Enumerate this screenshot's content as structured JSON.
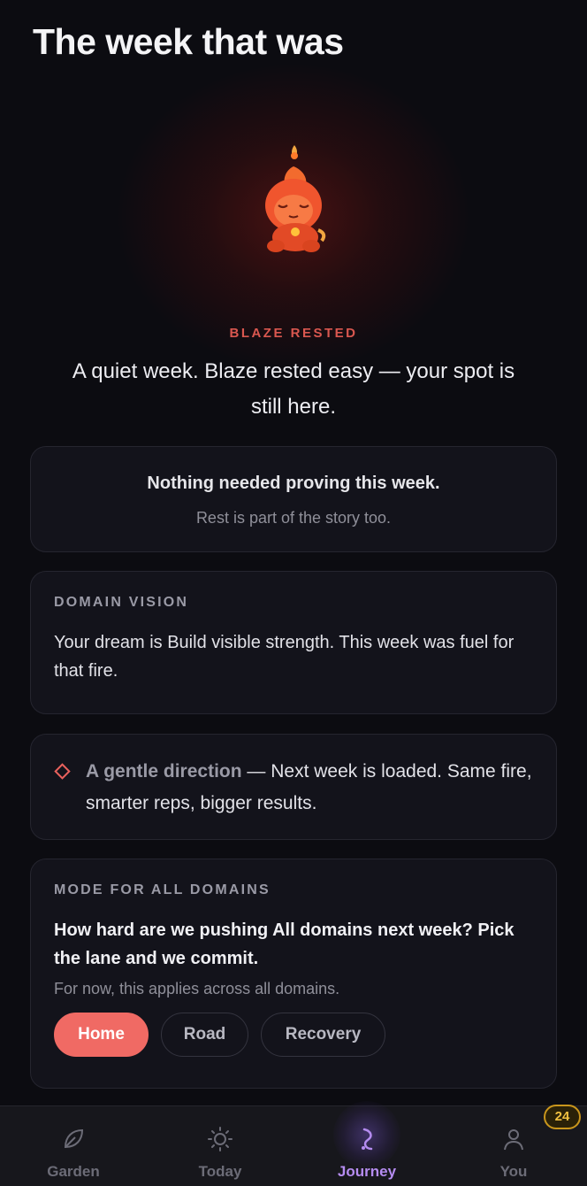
{
  "page_title": "The week that was",
  "hero": {
    "eyebrow": "BLAZE RESTED",
    "headline": "A quiet week. Blaze rested easy — your spot is still here."
  },
  "summary_card": {
    "title": "Nothing needed proving this week.",
    "subtitle": "Rest is part of the story too."
  },
  "vision_card": {
    "label": "DOMAIN VISION",
    "body": "Your dream is Build visible strength. This week was fuel for that fire."
  },
  "direction_card": {
    "emphasis": "A gentle direction",
    "separator": " — ",
    "body": "Next week is loaded. Same fire, smarter reps, bigger results."
  },
  "mode_card": {
    "label": "MODE FOR ALL DOMAINS",
    "question": "How hard are we pushing All domains next week? Pick the lane and we commit.",
    "note": "For now, this applies across all domains.",
    "options": [
      "Home",
      "Road",
      "Recovery"
    ],
    "selected": "Home"
  },
  "tabbar": {
    "tabs": [
      {
        "label": "Garden",
        "icon": "leaf-icon"
      },
      {
        "label": "Today",
        "icon": "sun-icon"
      },
      {
        "label": "Journey",
        "icon": "path-icon"
      },
      {
        "label": "You",
        "icon": "person-icon"
      }
    ],
    "active": "Journey",
    "badge": "24"
  },
  "colors": {
    "accent": "#f06a64",
    "eyebrow": "#d9574f",
    "active_tab": "#b58cf0",
    "badge": "#f0c040",
    "background": "#0c0c11",
    "card": "#13131b"
  }
}
